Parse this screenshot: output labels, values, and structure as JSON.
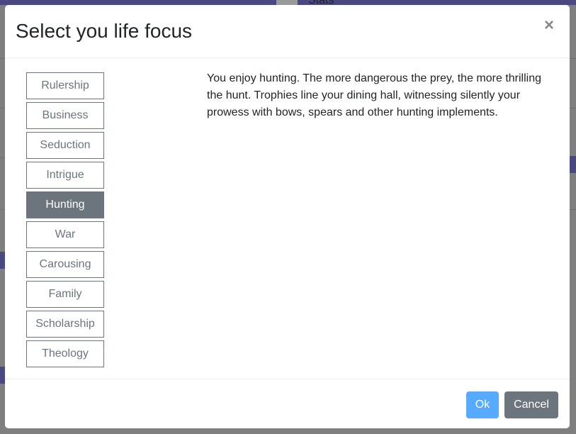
{
  "background": {
    "stats_label": "Stats"
  },
  "modal": {
    "title": "Select you life focus",
    "close_label": "×",
    "focuses": [
      {
        "label": "Rulership",
        "active": false
      },
      {
        "label": "Business",
        "active": false
      },
      {
        "label": "Seduction",
        "active": false
      },
      {
        "label": "Intrigue",
        "active": false
      },
      {
        "label": "Hunting",
        "active": true
      },
      {
        "label": "War",
        "active": false
      },
      {
        "label": "Carousing",
        "active": false
      },
      {
        "label": "Family",
        "active": false
      },
      {
        "label": "Scholarship",
        "active": false
      },
      {
        "label": "Theology",
        "active": false
      }
    ],
    "description": "You enjoy hunting. The more dangerous the prey, the more thrilling the hunt. Trophies line your dining hall, witnessing silently your prowess with bows, spears and other hunting implements.",
    "ok_label": "Ok",
    "cancel_label": "Cancel"
  },
  "colors": {
    "primary": "#56aaff",
    "secondary": "#6c757d",
    "nav": "#4a4880"
  }
}
